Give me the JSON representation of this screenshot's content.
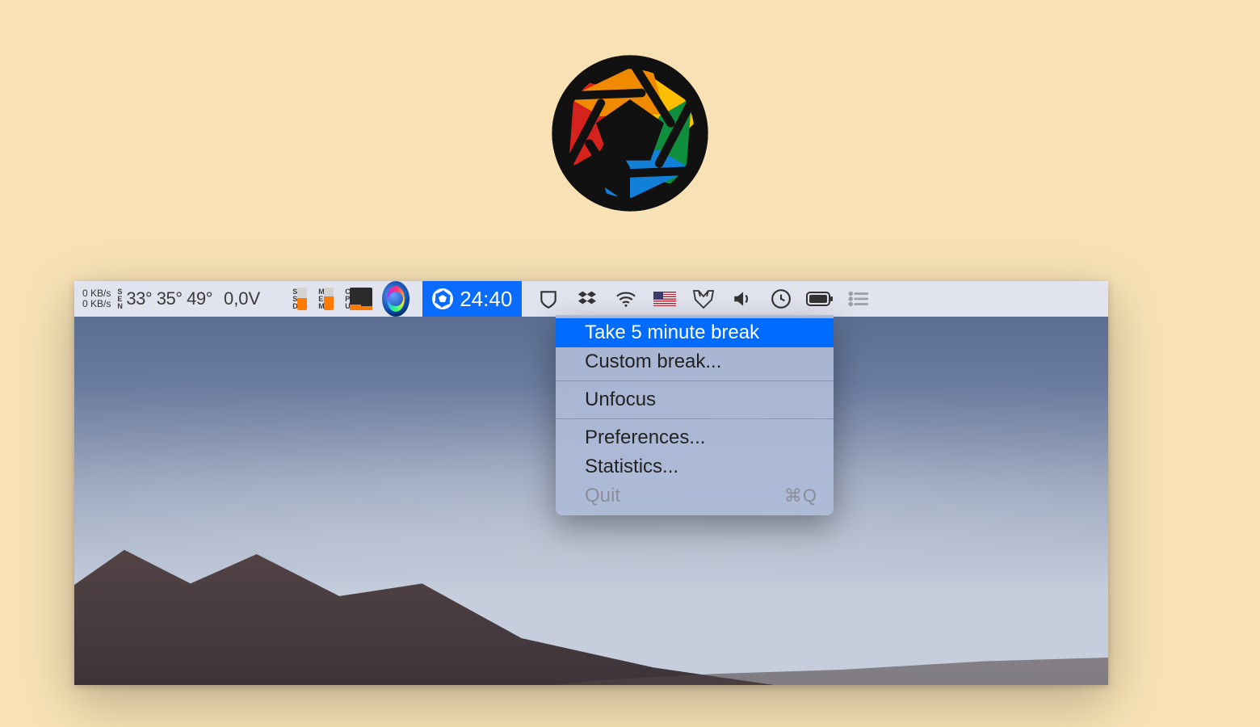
{
  "logo": {
    "name": "aperture-app-logo"
  },
  "menubar": {
    "network": {
      "up": "0 KB/s",
      "down": "0 KB/s"
    },
    "sensor_label": "SEN",
    "temps": [
      "33°",
      "35°",
      "49°"
    ],
    "voltage": "0,0V",
    "stats": [
      {
        "label": "SSD",
        "fill_pct": 55
      },
      {
        "label": "MEM",
        "fill_pct": 62
      },
      {
        "label": "CPU",
        "fill_left_pct": 25,
        "fill_right_pct": 18,
        "double": true
      }
    ],
    "timer": "24:40",
    "icons": [
      "siri-icon",
      "shield-outline-icon",
      "dropbox-icon",
      "wifi-icon",
      "us-flag-icon",
      "fox-outline-icon",
      "volume-icon",
      "clock-icon",
      "battery-icon",
      "list-icon"
    ]
  },
  "dropdown": {
    "items": [
      {
        "label": "Take 5 minute break",
        "highlight": true
      },
      {
        "label": "Custom break..."
      },
      {
        "sep": true
      },
      {
        "label": "Unfocus"
      },
      {
        "sep": true
      },
      {
        "label": "Preferences..."
      },
      {
        "label": "Statistics..."
      },
      {
        "label": "Quit",
        "disabled": true,
        "shortcut": "⌘Q"
      }
    ]
  }
}
